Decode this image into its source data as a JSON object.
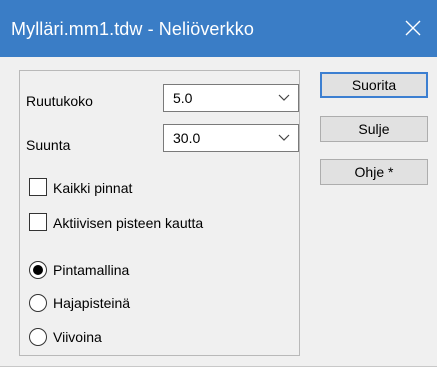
{
  "window": {
    "title": "Mylläri.mm1.tdw - Neliöverkko",
    "titlebar_color": "#3a7dc6",
    "close_icon": "close-icon"
  },
  "form": {
    "grid_size": {
      "label": "Ruutukoko",
      "value": "5.0",
      "icon": "chevron-down-icon"
    },
    "direction": {
      "label": "Suunta",
      "value": "30.0",
      "icon": "chevron-down-icon"
    },
    "all_surfaces": {
      "label": "Kaikki pinnat",
      "checked": false
    },
    "through_active_point": {
      "label": "Aktiivisen pisteen kautta",
      "checked": false
    },
    "mode": {
      "options": [
        "Pintamallina",
        "Hajapisteinä",
        "Viivoina"
      ],
      "selected": "Pintamallina"
    }
  },
  "buttons": {
    "run": "Suorita",
    "close": "Sulje",
    "help": "Ohje *",
    "default_border_color": "#3c7fd1"
  }
}
